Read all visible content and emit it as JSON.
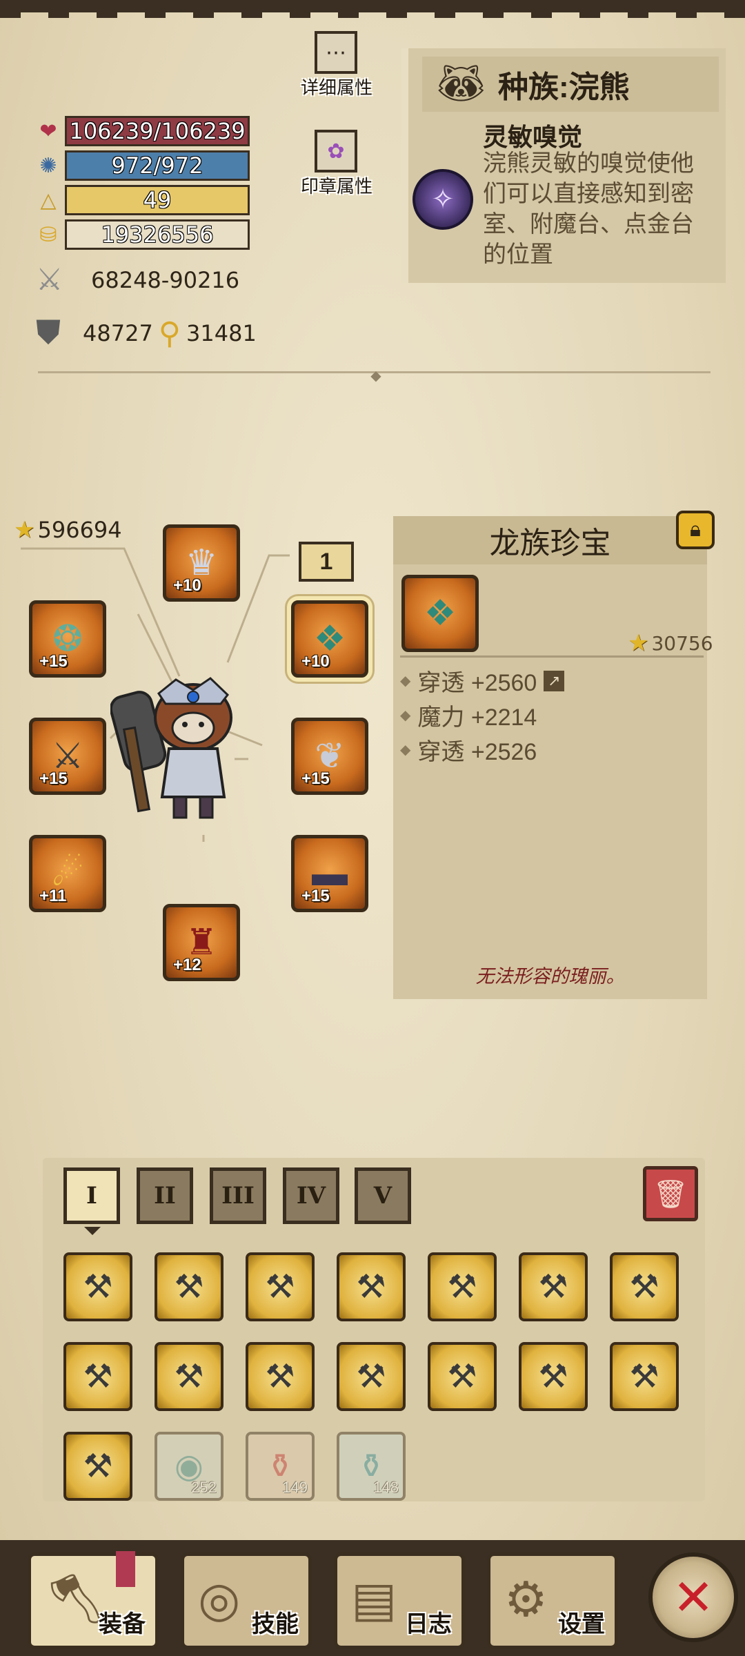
{
  "stats": {
    "hp": "106239/106239",
    "mp": "972/972",
    "level": "49",
    "gold": "19326556",
    "attack": "68248-90216",
    "defense": "48727",
    "magic_power": "31481"
  },
  "top_buttons": {
    "detail_attr": "详细属性",
    "seal_attr": "印章属性"
  },
  "race": {
    "title": "种族:浣熊",
    "skill_name": "灵敏嗅觉",
    "skill_desc": "浣熊灵敏的嗅觉使他们可以直接感知到密室、附魔台、点金台的位置"
  },
  "equipment": {
    "total_score": "596694",
    "tier_badge": "1",
    "slots": [
      {
        "name": "helmet",
        "level": "+10",
        "icon": "crown-icon"
      },
      {
        "name": "amulet",
        "level": "+10",
        "icon": "gem-icon"
      },
      {
        "name": "ring",
        "level": "+15",
        "icon": "ring-icon"
      },
      {
        "name": "shoulder",
        "level": "+15",
        "icon": "wings-icon"
      },
      {
        "name": "weapon",
        "level": "+15",
        "icon": "sword-icon"
      },
      {
        "name": "belt",
        "level": "+15",
        "icon": "belt-icon"
      },
      {
        "name": "bracer",
        "level": "+11",
        "icon": "bracer-icon"
      },
      {
        "name": "boots",
        "level": "+12",
        "icon": "boots-icon"
      }
    ]
  },
  "item_detail": {
    "title": "龙族珍宝",
    "score": "30756",
    "attrs": [
      "穿透 +2560",
      "魔力 +2214",
      "穿透 +2526"
    ],
    "flavor": "无法形容的瑰丽。"
  },
  "inventory": {
    "tabs": [
      "I",
      "II",
      "III",
      "IV",
      "V"
    ],
    "active_tab": "I",
    "special_counts": [
      "252",
      "149",
      "148"
    ]
  },
  "nav": {
    "equip": "装备",
    "skill": "技能",
    "log": "日志",
    "settings": "设置"
  },
  "colors": {
    "hp_bar": "#8e3b44",
    "mp_bar": "#4d7fab",
    "level_bar": "#e6c869",
    "close_x": "#c8202a"
  }
}
